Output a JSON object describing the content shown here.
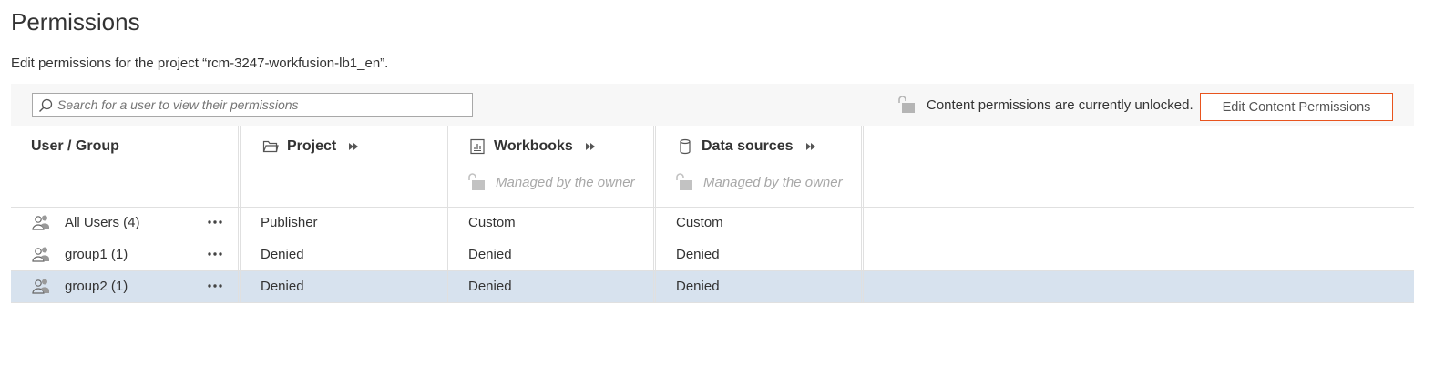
{
  "page": {
    "title": "Permissions",
    "subtitle": "Edit permissions for the project “rcm-3247-workfusion-lb1_en”."
  },
  "toolbar": {
    "search_placeholder": "Search for a user to view their permissions",
    "lock_status": "Content permissions are currently unlocked.",
    "edit_button": "Edit Content Permissions"
  },
  "table": {
    "user_header": "User / Group",
    "columns": [
      {
        "label": "Project",
        "icon": "folder-icon",
        "managed": ""
      },
      {
        "label": "Workbooks",
        "icon": "workbook-icon",
        "managed": "Managed by the owner"
      },
      {
        "label": "Data sources",
        "icon": "database-icon",
        "managed": "Managed by the owner"
      }
    ],
    "rows": [
      {
        "name": "All Users (4)",
        "cells": [
          "Publisher",
          "Custom",
          "Custom"
        ],
        "selected": false
      },
      {
        "name": "group1 (1)",
        "cells": [
          "Denied",
          "Denied",
          "Denied"
        ],
        "selected": false
      },
      {
        "name": "group2 (1)",
        "cells": [
          "Denied",
          "Denied",
          "Denied"
        ],
        "selected": true
      }
    ]
  },
  "colors": {
    "accent_border": "#e8541e",
    "selected_row": "#d7e2ee",
    "toolbar_bg": "#f7f7f7"
  }
}
